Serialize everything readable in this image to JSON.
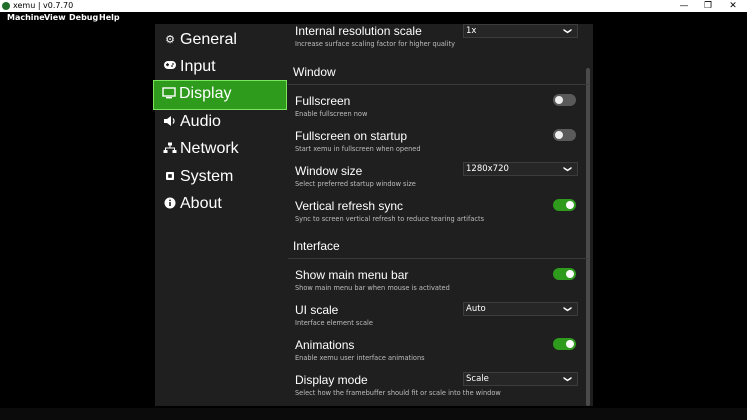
{
  "window": {
    "title": "xemu | v0.7.70",
    "minimize": "—",
    "restore": "❐",
    "close": "✕"
  },
  "menu": [
    "Machine",
    "View",
    "Debug",
    "Help"
  ],
  "sidebar": {
    "items": [
      {
        "label": "General",
        "icon": "gear-icon",
        "glyph": "⚙"
      },
      {
        "label": "Input",
        "icon": "gamepad-icon",
        "glyph": "🎮"
      },
      {
        "label": "Display",
        "icon": "monitor-icon",
        "glyph": "▭"
      },
      {
        "label": "Audio",
        "icon": "speaker-icon",
        "glyph": "◀)"
      },
      {
        "label": "Network",
        "icon": "network-icon",
        "glyph": "品"
      },
      {
        "label": "System",
        "icon": "chip-icon",
        "glyph": "▣"
      },
      {
        "label": "About",
        "icon": "info-icon",
        "glyph": "ℹ"
      }
    ],
    "active": "Display"
  },
  "settings": {
    "resolution": {
      "label": "Internal resolution scale",
      "desc": "Increase surface scaling factor for higher quality",
      "value": "1x"
    },
    "window_section": "Window",
    "fullscreen": {
      "label": "Fullscreen",
      "desc": "Enable fullscreen now",
      "on": false
    },
    "fullscreen_startup": {
      "label": "Fullscreen on startup",
      "desc": "Start xemu in fullscreen when opened",
      "on": false
    },
    "window_size": {
      "label": "Window size",
      "desc": "Select preferred startup window size",
      "value": "1280x720"
    },
    "vsync": {
      "label": "Vertical refresh sync",
      "desc": "Sync to screen vertical refresh to reduce tearing artifacts",
      "on": true
    },
    "interface_section": "Interface",
    "main_menu_bar": {
      "label": "Show main menu bar",
      "desc": "Show main menu bar when mouse is activated",
      "on": true
    },
    "ui_scale": {
      "label": "UI scale",
      "desc": "Interface element scale",
      "value": "Auto"
    },
    "animations": {
      "label": "Animations",
      "desc": "Enable xemu user interface animations",
      "on": true
    },
    "display_mode": {
      "label": "Display mode",
      "desc": "Select how the framebuffer should fit or scale into the window",
      "value": "Scale"
    }
  },
  "colors": {
    "accent": "#2e9b1d",
    "accent_border": "#7be55e",
    "panel": "#1f1f1f"
  }
}
